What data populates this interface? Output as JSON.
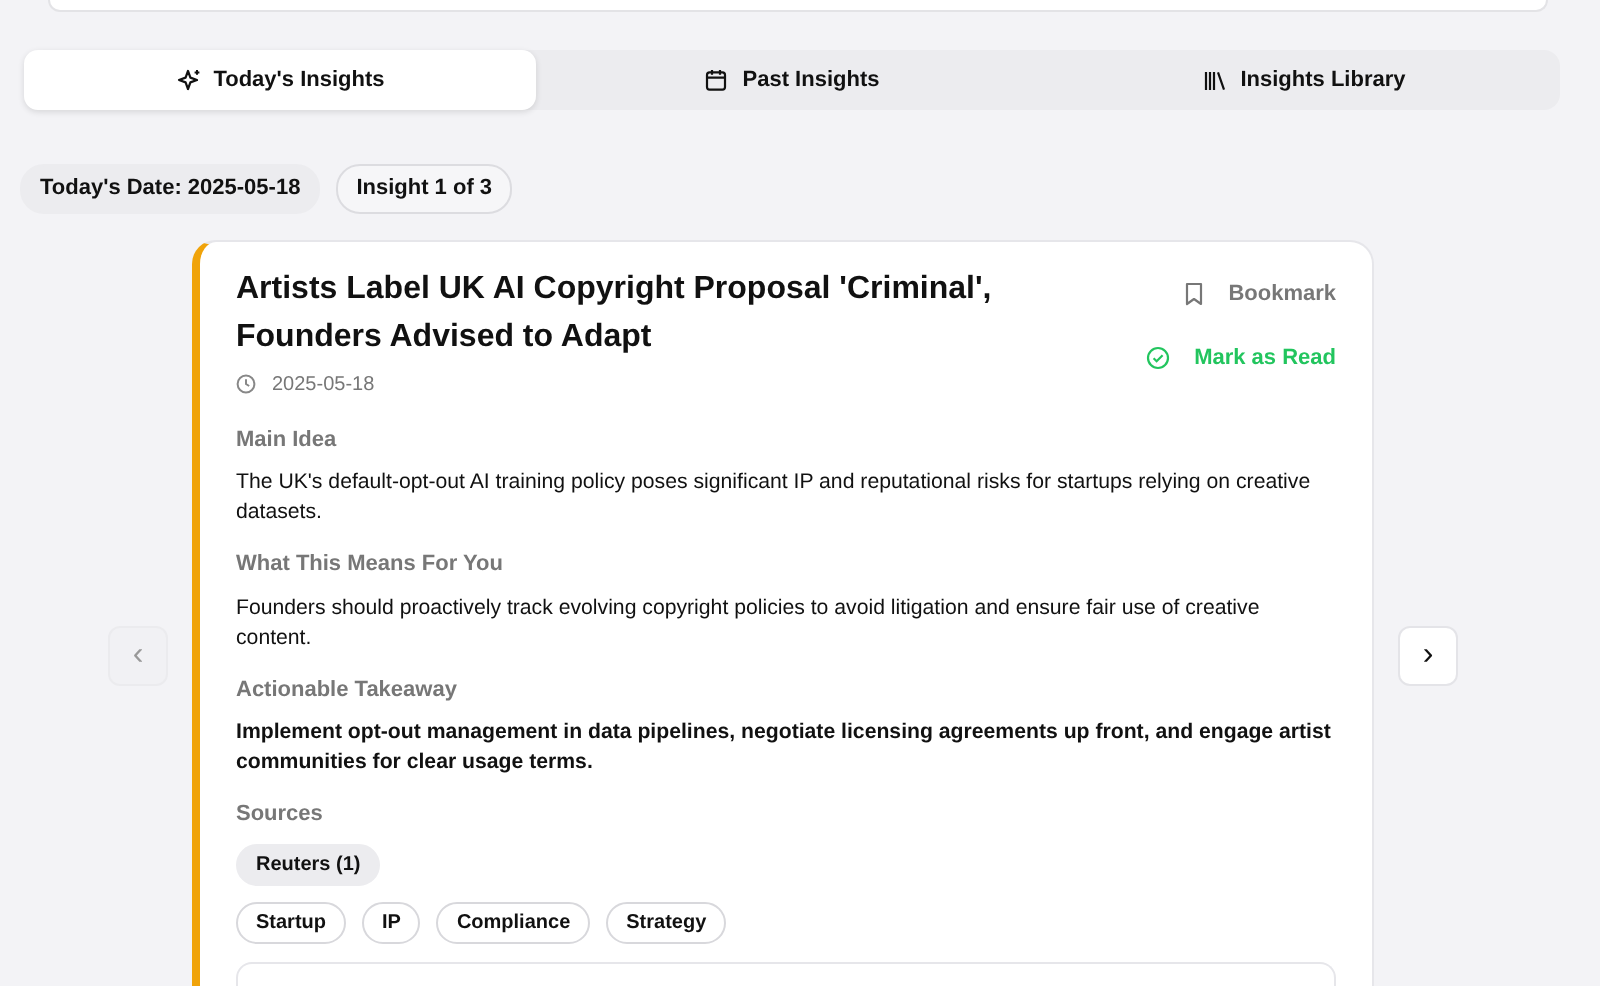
{
  "tabs": [
    {
      "label": "Today's Insights",
      "kind": "sparkles",
      "selected": true
    },
    {
      "label": "Past Insights",
      "kind": "calendar",
      "selected": false
    },
    {
      "label": "Insights Library",
      "kind": "library",
      "selected": false
    }
  ],
  "status_chips": [
    "Today's Date: 2025-05-18",
    "Insight 1 of 3"
  ],
  "prev_button": {
    "symbol": "‹",
    "disabled": true
  },
  "next_button": {
    "symbol": "›",
    "disabled": false
  },
  "insight": {
    "title": "Artists Label UK AI Copyright Proposal 'Criminal', Founders Advised to Adapt",
    "date": "2025-05-18",
    "bookmark": {
      "label": "Bookmark",
      "bookmarked": false
    },
    "mark_read": {
      "label": "Mark as Read",
      "read": false
    },
    "sections": [
      {
        "heading": "Main Idea",
        "text": "The UK's default-opt-out AI training policy poses significant IP and reputational risks for startups relying on creative datasets.",
        "emphasis": false
      },
      {
        "heading": "What This Means For You",
        "text": "Founders should proactively track evolving copyright policies to avoid litigation and ensure fair use of creative content.",
        "emphasis": false
      },
      {
        "heading": "Actionable Takeaway",
        "text": "Implement opt-out management in data pipelines, negotiate licensing agreements up front, and engage artist communities for clear usage terms.",
        "emphasis": true
      }
    ],
    "sources_heading": "Sources",
    "sources": [
      "Reuters (1)"
    ],
    "tags": [
      "Startup",
      "IP",
      "Compliance",
      "Strategy"
    ]
  }
}
